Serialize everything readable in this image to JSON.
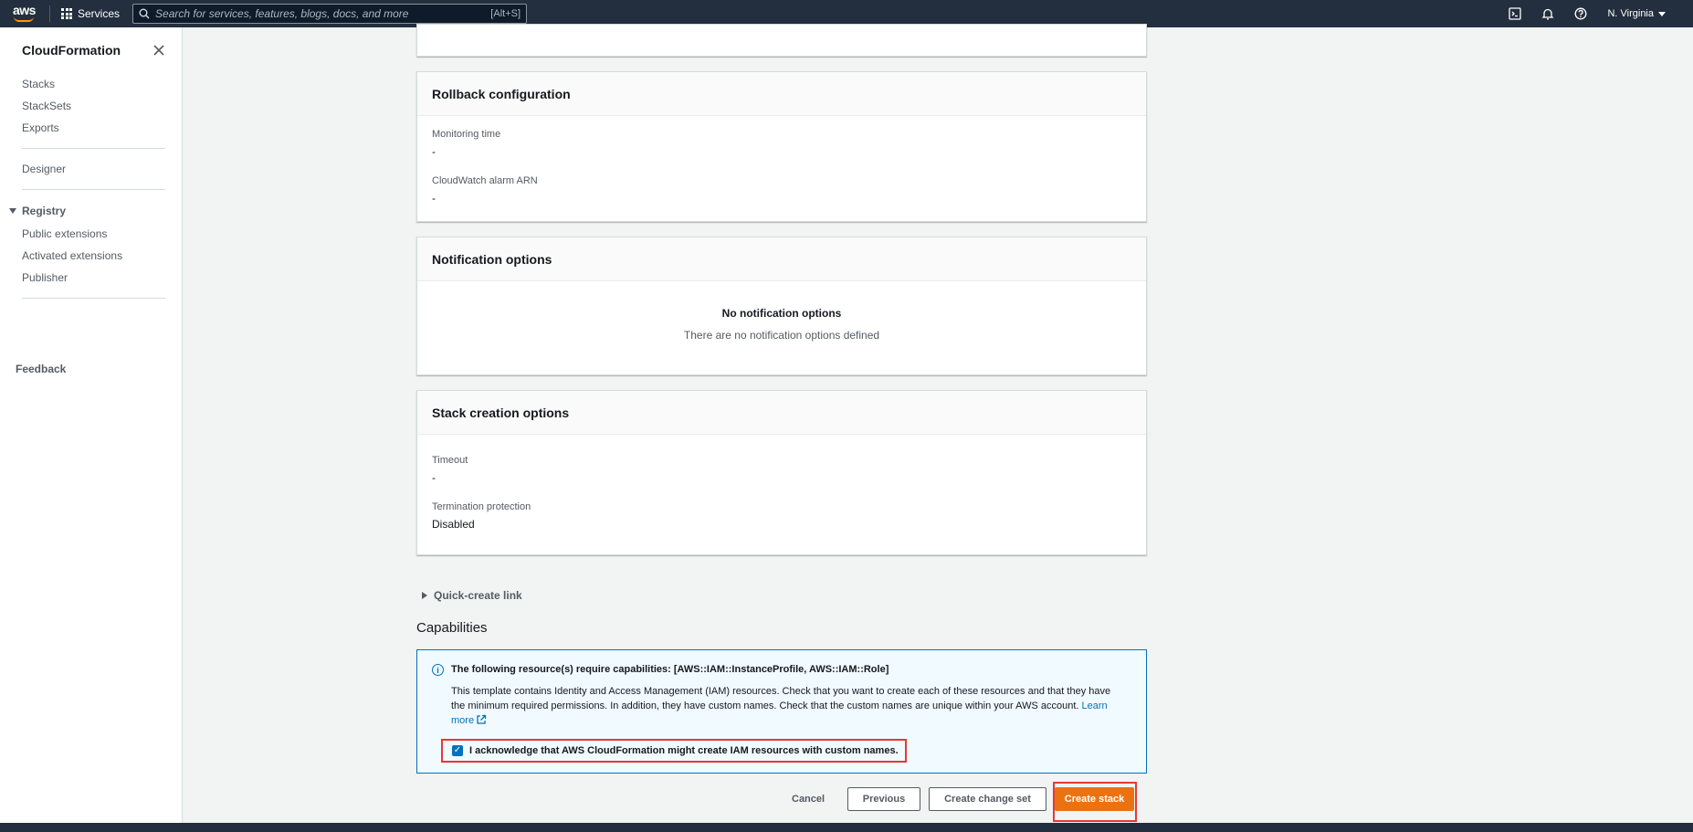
{
  "topnav": {
    "logo_text": "aws",
    "services_label": "Services",
    "search_placeholder": "Search for services, features, blogs, docs, and more",
    "search_shortcut": "[Alt+S]",
    "region": "N. Virginia"
  },
  "sidebar": {
    "title": "CloudFormation",
    "items_group1": [
      "Stacks",
      "StackSets",
      "Exports"
    ],
    "designer": "Designer",
    "registry": "Registry",
    "registry_items": [
      "Public extensions",
      "Activated extensions",
      "Publisher"
    ],
    "feedback": "Feedback"
  },
  "rollback": {
    "title": "Rollback configuration",
    "monitoring_label": "Monitoring time",
    "monitoring_value": "-",
    "alarm_label": "CloudWatch alarm ARN",
    "alarm_value": "-"
  },
  "notification": {
    "title": "Notification options",
    "empty_title": "No notification options",
    "empty_desc": "There are no notification options defined"
  },
  "stack_creation": {
    "title": "Stack creation options",
    "timeout_label": "Timeout",
    "timeout_value": "-",
    "termination_label": "Termination protection",
    "termination_value": "Disabled"
  },
  "quick_create": "Quick-create link",
  "capabilities": {
    "title": "Capabilities",
    "heading": "The following resource(s) require capabilities: [AWS::IAM::InstanceProfile, AWS::IAM::Role]",
    "body": "This template contains Identity and Access Management (IAM) resources. Check that you want to create each of these resources and that they have the minimum required permissions. In addition, they have custom names. Check that the custom names are unique within your AWS account.",
    "learn_more": "Learn more",
    "ack_label": "I acknowledge that AWS CloudFormation might create IAM resources with custom names.",
    "ack_checked": true
  },
  "actions": {
    "cancel": "Cancel",
    "previous": "Previous",
    "create_change_set": "Create change set",
    "create_stack": "Create stack"
  },
  "colors": {
    "nav_bg": "#232f3e",
    "primary": "#ec7211",
    "link": "#0073bb",
    "highlight": "#e53935"
  }
}
